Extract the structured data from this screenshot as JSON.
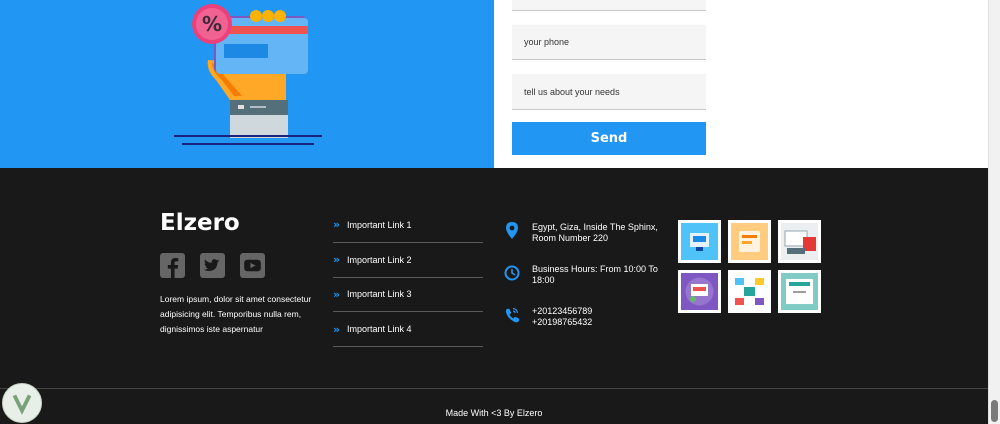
{
  "form": {
    "phone_placeholder": "your phone",
    "needs_placeholder": "tell us about your needs",
    "send_label": "Send"
  },
  "footer": {
    "brand": "Elzero",
    "about": "Lorem ipsum, dolor sit amet consectetur adipisicing elit. Temporibus nulla rem, dignissimos iste aspernatur",
    "links": [
      {
        "label": "Important Link 1"
      },
      {
        "label": "Important Link 2"
      },
      {
        "label": "Important Link 3"
      },
      {
        "label": "Important Link 4"
      }
    ],
    "address_line1": "Egypt, Giza, Inside The Sphinx,",
    "address_line2": "Room Number 220",
    "hours_line1": "Business Hours: From 10:00 To",
    "hours_line2": "18:00",
    "phone1": "+20123456789",
    "phone2": "+20198765432",
    "made_with": "Made With <3 By Elzero"
  },
  "colors": {
    "accent": "#2196f3",
    "footer_bg": "#191919"
  },
  "icons": [
    "facebook-icon",
    "twitter-icon",
    "youtube-icon",
    "location-icon",
    "clock-icon",
    "phone-icon",
    "chevron-right-icon"
  ]
}
